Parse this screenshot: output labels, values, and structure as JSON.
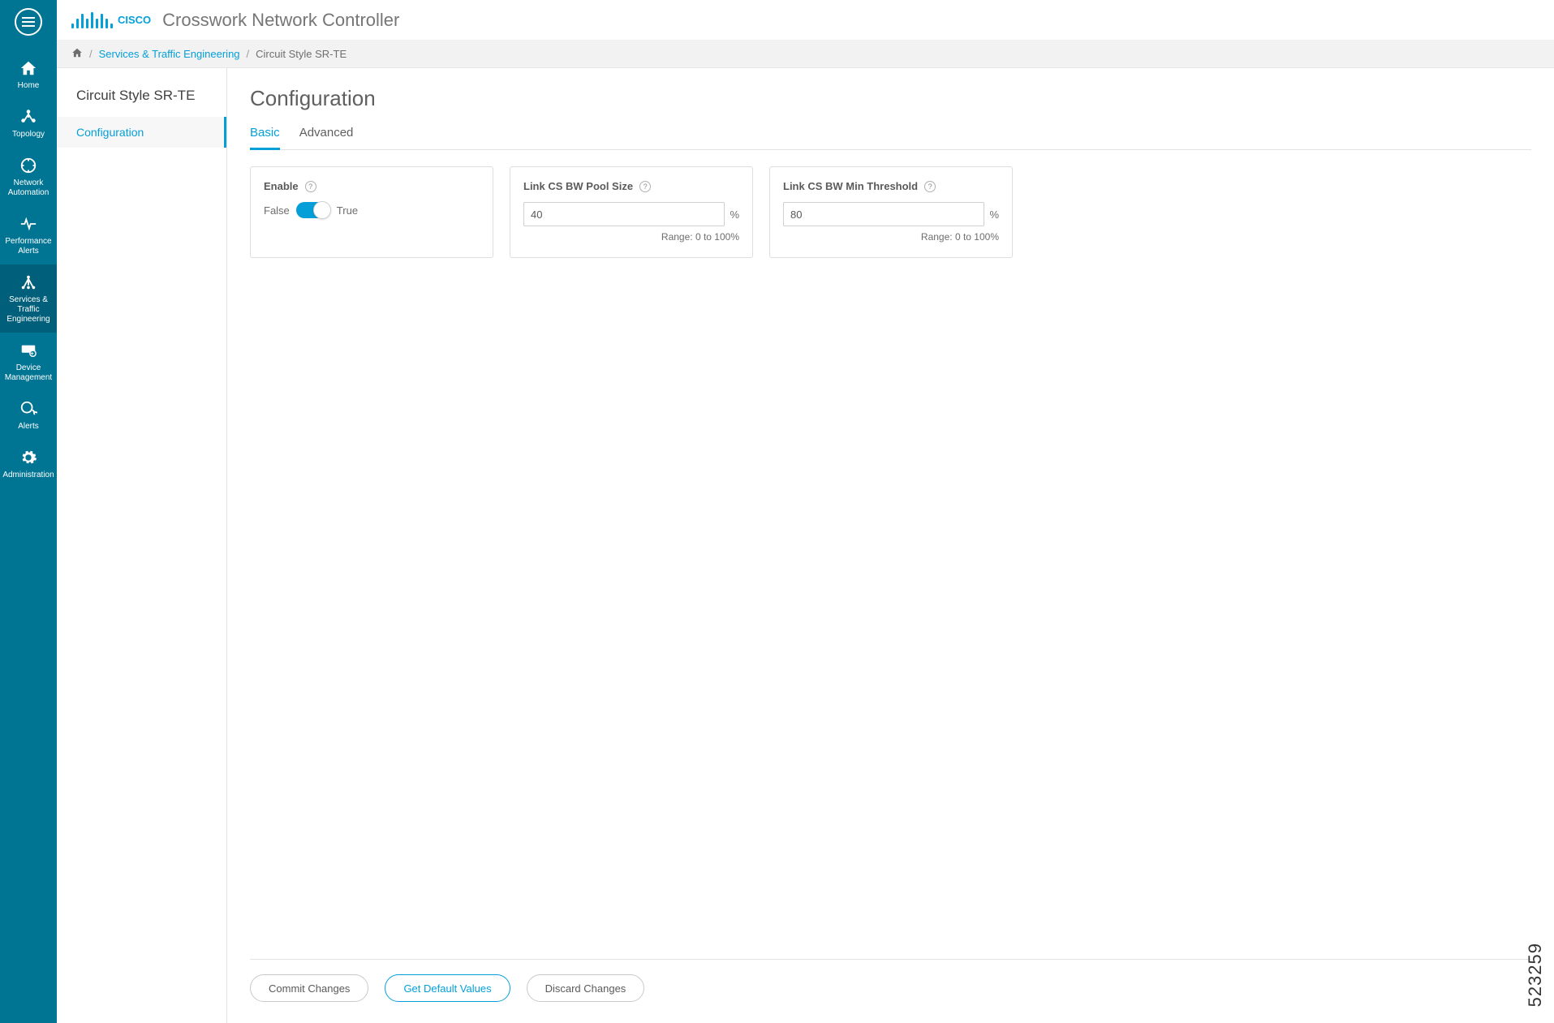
{
  "brand": {
    "name": "CISCO",
    "product": "Crosswork Network Controller"
  },
  "sidebar": {
    "items": [
      {
        "label": "Home"
      },
      {
        "label": "Topology"
      },
      {
        "label": "Network Automation"
      },
      {
        "label": "Performance Alerts"
      },
      {
        "label": "Services & Traffic Engineering"
      },
      {
        "label": "Device Management"
      },
      {
        "label": "Alerts"
      },
      {
        "label": "Administration"
      }
    ]
  },
  "breadcrumb": {
    "link": "Services & Traffic Engineering",
    "current": "Circuit Style SR-TE",
    "sep": "/"
  },
  "left_panel": {
    "title": "Circuit Style SR-TE",
    "items": [
      {
        "label": "Configuration"
      }
    ]
  },
  "page": {
    "title": "Configuration"
  },
  "tabs": [
    {
      "label": "Basic"
    },
    {
      "label": "Advanced"
    }
  ],
  "cards": {
    "enable": {
      "label": "Enable",
      "false_label": "False",
      "true_label": "True"
    },
    "pool_size": {
      "label": "Link CS BW Pool Size",
      "value": "40",
      "unit": "%",
      "range": "Range: 0 to 100%"
    },
    "min_threshold": {
      "label": "Link CS BW Min Threshold",
      "value": "80",
      "unit": "%",
      "range": "Range: 0 to 100%"
    }
  },
  "footer": {
    "commit": "Commit Changes",
    "defaults": "Get Default Values",
    "discard": "Discard Changes"
  },
  "watermark": "523259"
}
